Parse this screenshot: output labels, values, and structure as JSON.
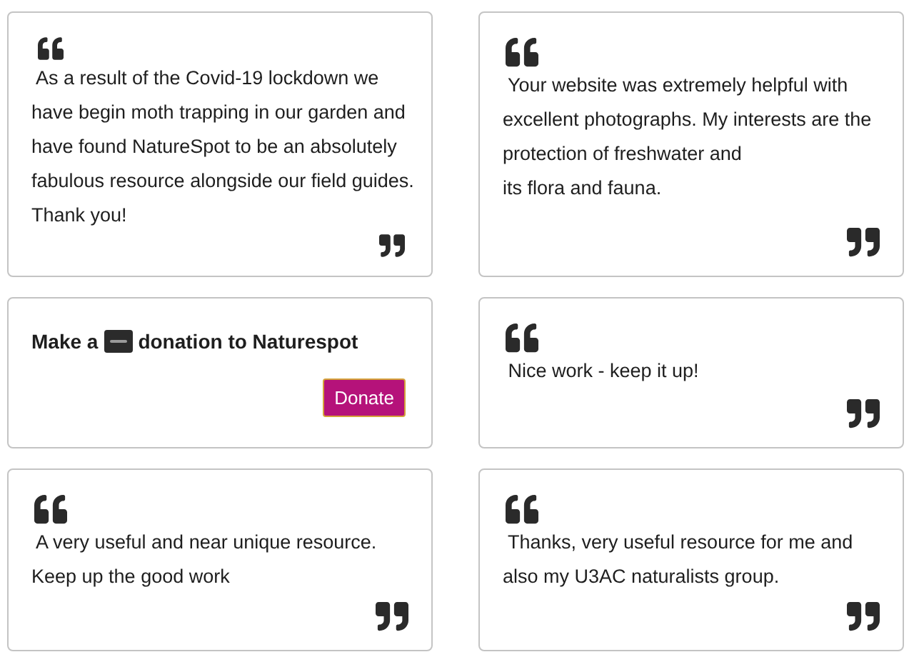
{
  "cards": [
    {
      "kind": "quote",
      "lines": [
        " As a result of the Covid-19 lockdown we",
        "have begin moth trapping in our garden and",
        "have found NatureSpot to be an absolutely",
        "fabulous resource alongside our field guides.",
        "Thank you!"
      ]
    },
    {
      "kind": "quote",
      "lines": [
        " Your website was extremely helpful with",
        "excellent photographs. My interests are the",
        "protection of freshwater and",
        "its flora and fauna."
      ]
    },
    {
      "kind": "donate",
      "before": "Make a",
      "after": "donation to Naturespot",
      "button": "Donate"
    },
    {
      "kind": "quote",
      "lines": [
        " Nice work - keep it up!"
      ]
    },
    {
      "kind": "quote",
      "lines": [
        " A very useful and near unique resource.",
        "Keep up the good work"
      ]
    },
    {
      "kind": "quote",
      "lines": [
        " Thanks, very useful resource for me and",
        "also my U3AC naturalists group."
      ]
    }
  ]
}
